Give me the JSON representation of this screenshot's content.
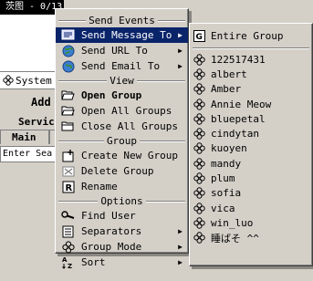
{
  "background": {
    "group_bar": "茨图 - 0/13",
    "status": "System",
    "add": "Add",
    "service": "Service",
    "main_tab": "Main",
    "search": "Enter Sea"
  },
  "main_menu": {
    "sections": [
      {
        "header": "Send Events",
        "items": [
          {
            "label": "Send Message To",
            "icon": "message-icon",
            "submenu": true,
            "highlight": true
          },
          {
            "label": "Send URL To",
            "icon": "globe-icon",
            "submenu": true
          },
          {
            "label": "Send Email To",
            "icon": "email-icon",
            "submenu": true
          }
        ]
      },
      {
        "header": "View",
        "items": [
          {
            "label": "Open Group",
            "icon": "open-folder-icon",
            "bold": true
          },
          {
            "label": "Open All Groups",
            "icon": "folders-icon"
          },
          {
            "label": "Close All Groups",
            "icon": "close-folders-icon"
          }
        ]
      },
      {
        "header": "Group",
        "items": [
          {
            "label": "Create New Group",
            "icon": "new-group-icon"
          },
          {
            "label": "Delete Group",
            "icon": "delete-group-icon"
          },
          {
            "label": "Rename",
            "icon": "rename-icon"
          }
        ]
      },
      {
        "header": "Options",
        "items": [
          {
            "label": "Find User",
            "icon": "find-icon"
          },
          {
            "label": "Separators",
            "icon": "separators-icon",
            "submenu": true
          },
          {
            "label": "Group Mode",
            "icon": "group-mode-icon",
            "submenu": true
          },
          {
            "label": "Sort",
            "icon": "sort-icon",
            "submenu": true
          }
        ]
      }
    ]
  },
  "sub_menu": {
    "entire_group": "Entire Group",
    "contacts": [
      "122517431",
      "albert",
      "Amber",
      "Annie Meow",
      "bluepetal",
      "cindytan",
      "kuoyen",
      "mandy",
      "plum",
      "sofia",
      "vica",
      "win_luo",
      "睡ばそ  ^^"
    ]
  },
  "colors": {
    "menu_bg": "#d4d0c8",
    "highlight": "#0a246a"
  }
}
